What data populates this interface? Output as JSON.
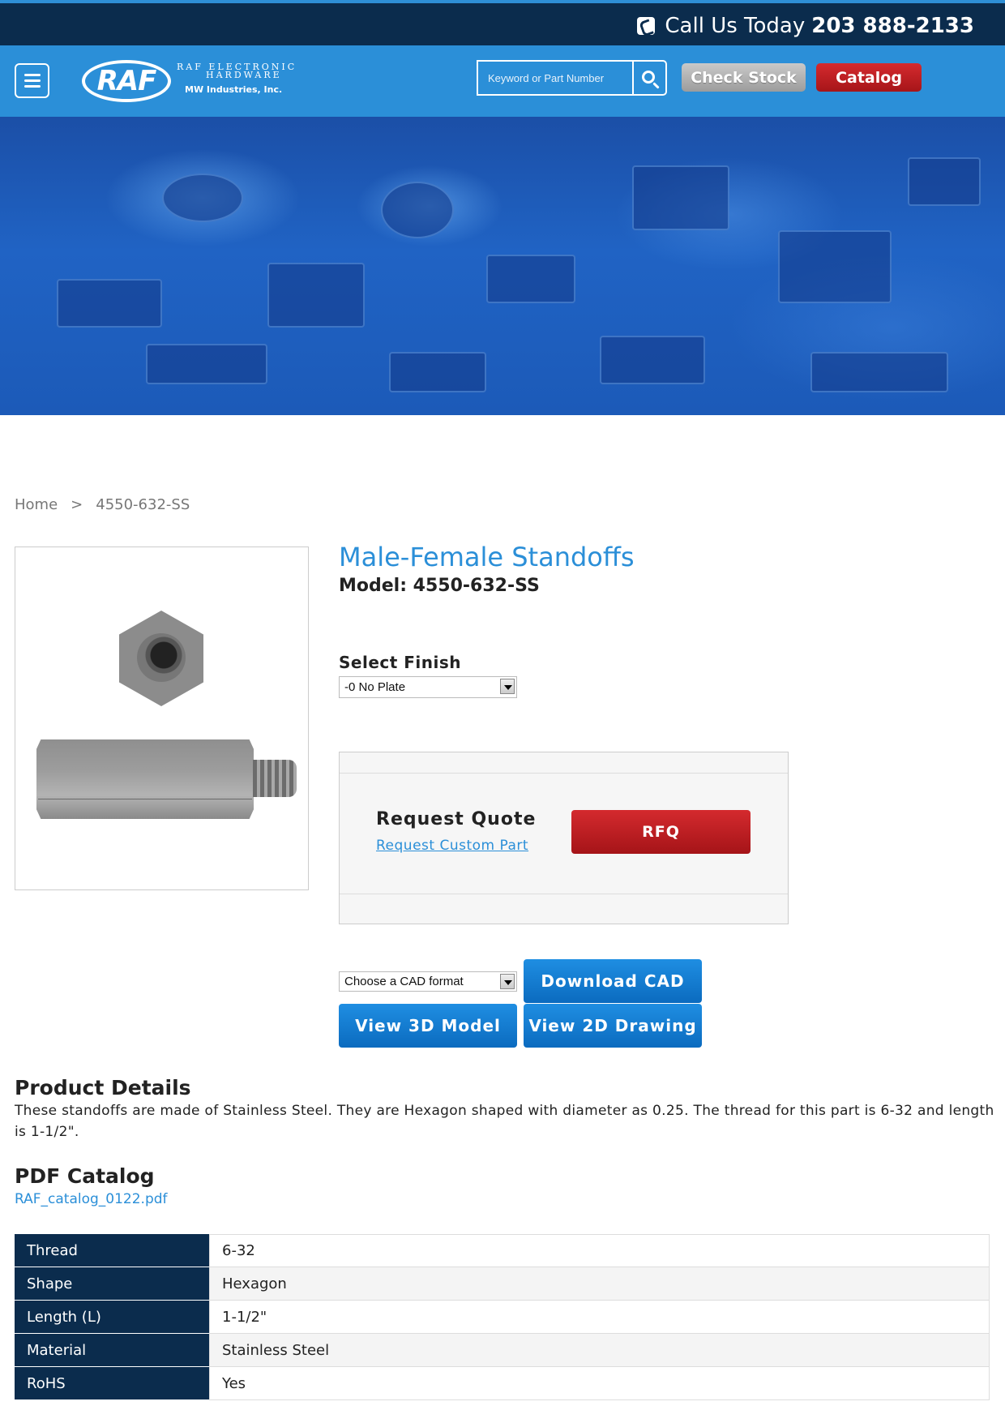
{
  "topbar": {
    "call_label": "Call Us Today",
    "phone": "203 888-2133"
  },
  "header": {
    "logo": "RAF",
    "logo_line1": "RAF ELECTRONIC",
    "logo_line2": "HARDWARE",
    "logo_line3": "MW Industries, Inc.",
    "search_placeholder": "Keyword or Part Number",
    "check_stock": "Check Stock",
    "catalog": "Catalog"
  },
  "breadcrumb": {
    "home": "Home",
    "sep": ">",
    "current": "4550-632-SS"
  },
  "product": {
    "title": "Male-Female Standoffs",
    "model": "Model: 4550-632-SS",
    "finish_label": "Select Finish",
    "finish_value": "-0 No Plate"
  },
  "quote": {
    "title": "Request Quote",
    "link": "Request Custom Part",
    "button": "RFQ"
  },
  "cad": {
    "select_value": "Choose a CAD format",
    "download": "Download CAD",
    "view3d": "View 3D Model",
    "view2d": "View 2D Drawing"
  },
  "details": {
    "heading": "Product Details",
    "text": "These standoffs are made of Stainless Steel. They are Hexagon shaped with diameter as 0.25. The thread for this part is 6-32 and length is 1-1/2\"."
  },
  "pdf": {
    "heading": "PDF Catalog",
    "link": "RAF_catalog_0122.pdf"
  },
  "specs": [
    {
      "key": "Thread",
      "value": "6-32"
    },
    {
      "key": "Shape",
      "value": "Hexagon"
    },
    {
      "key": "Length (L)",
      "value": "1-1/2\""
    },
    {
      "key": "Material",
      "value": "Stainless Steel"
    },
    {
      "key": "RoHS",
      "value": "Yes"
    }
  ],
  "colors": {
    "navy": "#0b2c4d",
    "header_blue": "#2b8fd8",
    "accent_red": "#c21f23",
    "button_blue": "#1578cc"
  }
}
